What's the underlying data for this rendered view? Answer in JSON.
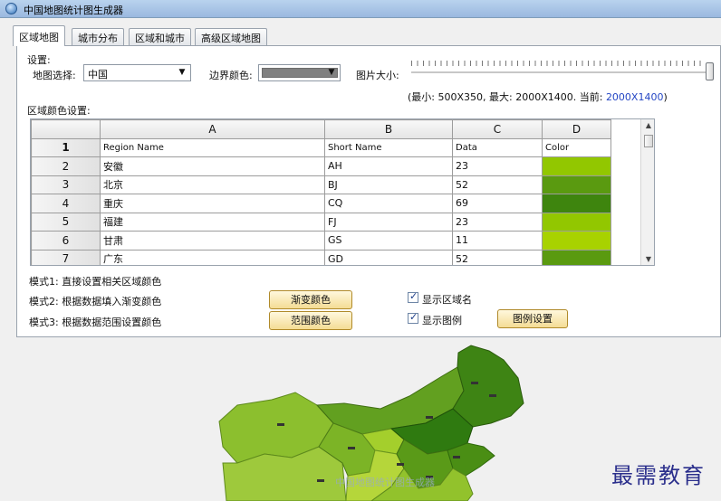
{
  "window": {
    "title": "中国地图统计图生成器"
  },
  "tabs": [
    "区域地图",
    "城市分布",
    "区域和城市",
    "高级区域地图"
  ],
  "settings": {
    "section_label": "设置:",
    "map_select_label": "地图选择:",
    "map_select_value": "中国",
    "border_color_label": "边界颜色:",
    "border_color": "#808080",
    "image_size_label": "图片大小:",
    "size_info_prefix": "(最小: 500X350, 最大: 2000X1400. 当前: ",
    "size_current": "2000X1400",
    "size_info_suffix": ")",
    "slider_fraction": 1.0
  },
  "region_color_label": "区域颜色设置:",
  "grid": {
    "columns": [
      "A",
      "B",
      "C",
      "D"
    ],
    "header_row": {
      "num": "1",
      "cells": [
        "Region Name",
        "Short Name",
        "Data",
        "Color"
      ]
    },
    "rows": [
      {
        "num": "2",
        "name": "安徽",
        "short": "AH",
        "data": "23",
        "color": "#92c700"
      },
      {
        "num": "3",
        "name": "北京",
        "short": "BJ",
        "data": "52",
        "color": "#5a9a10"
      },
      {
        "num": "4",
        "name": "重庆",
        "short": "CQ",
        "data": "69",
        "color": "#3e850e"
      },
      {
        "num": "5",
        "name": "福建",
        "short": "FJ",
        "data": "23",
        "color": "#92c700"
      },
      {
        "num": "6",
        "name": "甘肃",
        "short": "GS",
        "data": "11",
        "color": "#a8d200"
      },
      {
        "num": "7",
        "name": "广东",
        "short": "GD",
        "data": "52",
        "color": "#5a9a10"
      }
    ]
  },
  "modes": {
    "mode1": "模式1: 直接设置相关区域颜色",
    "mode2": "模式2: 根据数据填入渐变颜色",
    "mode3": "模式3: 根据数据范围设置颜色",
    "gradient_button": "渐变颜色",
    "range_button": "范围颜色",
    "show_region_name": "显示区域名",
    "show_legend": "显示图例",
    "legend_settings_button": "图例设置"
  },
  "preview": {
    "caption": "中国地图统计图生成器"
  },
  "watermark": "最需教育"
}
